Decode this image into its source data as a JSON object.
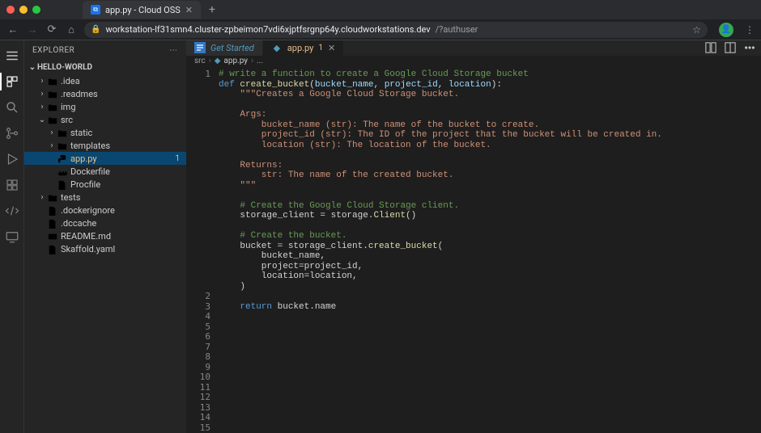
{
  "browser": {
    "tab_title": "app.py - Cloud OSS",
    "url_host": "workstation-lf31smn4.cluster-zpbeimon7vdi6xjptfsrgnp64y.cloudworkstations.dev",
    "url_path": "/?authuser"
  },
  "sidebar": {
    "title": "EXPLORER",
    "project": "HELLO-WORLD"
  },
  "tree": [
    {
      "depth": 1,
      "chev": "›",
      "kind": "folder",
      "label": ".idea"
    },
    {
      "depth": 1,
      "chev": "›",
      "kind": "folder",
      "label": ".readmes"
    },
    {
      "depth": 1,
      "chev": "›",
      "kind": "folder",
      "label": "img"
    },
    {
      "depth": 1,
      "chev": "⌄",
      "kind": "folder",
      "label": "src"
    },
    {
      "depth": 2,
      "chev": "›",
      "kind": "folder",
      "label": "static"
    },
    {
      "depth": 2,
      "chev": "›",
      "kind": "folder",
      "label": "templates"
    },
    {
      "depth": 2,
      "chev": "",
      "kind": "py",
      "label": "app.py",
      "selected": true,
      "modified": true,
      "badge": "1"
    },
    {
      "depth": 2,
      "chev": "",
      "kind": "docker",
      "label": "Dockerfile"
    },
    {
      "depth": 2,
      "chev": "",
      "kind": "file",
      "label": "Procfile"
    },
    {
      "depth": 1,
      "chev": "›",
      "kind": "folder",
      "label": "tests"
    },
    {
      "depth": 1,
      "chev": "",
      "kind": "file",
      "label": ".dockerignore"
    },
    {
      "depth": 1,
      "chev": "",
      "kind": "file",
      "label": ".dccache"
    },
    {
      "depth": 1,
      "chev": "",
      "kind": "md",
      "label": "README.md"
    },
    {
      "depth": 1,
      "chev": "",
      "kind": "yaml",
      "label": "Skaffold.yaml"
    }
  ],
  "editor_tabs": [
    {
      "kind": "gs",
      "label": "Get Started",
      "active": false
    },
    {
      "kind": "py",
      "label": "app.py",
      "badge": "1",
      "active": true,
      "closeable": true
    }
  ],
  "breadcrumb": {
    "seg1": "src",
    "seg2": "app.py",
    "seg3": "..."
  },
  "code_lines": [
    {
      "n": "1",
      "html": "<span class='tok-comment'># write a function to create a Google Cloud Storage bucket</span>"
    },
    {
      "n": "",
      "html": "<span class='tok-kw'>def</span> <span class='tok-fn'>create_bucket</span>(<span class='tok-param'>bucket_name</span>, <span class='tok-param'>project_id</span>, <span class='tok-param'>location</span>):"
    },
    {
      "n": "",
      "html": "    <span class='tok-str'>\"\"\"Creates a Google Cloud Storage bucket.</span>"
    },
    {
      "n": "",
      "html": ""
    },
    {
      "n": "",
      "html": "<span class='tok-str'>    Args:</span>"
    },
    {
      "n": "",
      "html": "<span class='tok-str'>        bucket_name (str): The name of the bucket to create.</span>"
    },
    {
      "n": "",
      "html": "<span class='tok-str'>        project_id (str): The ID of the project that the bucket will be created in.</span>"
    },
    {
      "n": "",
      "html": "<span class='tok-str'>        location (str): The location of the bucket.</span>"
    },
    {
      "n": "",
      "html": ""
    },
    {
      "n": "",
      "html": "<span class='tok-str'>    Returns:</span>"
    },
    {
      "n": "",
      "html": "<span class='tok-str'>        str: The name of the created bucket.</span>"
    },
    {
      "n": "",
      "html": "<span class='tok-str'>    \"\"\"</span>"
    },
    {
      "n": "",
      "html": ""
    },
    {
      "n": "",
      "html": "    <span class='tok-comment'># Create the Google Cloud Storage client.</span>"
    },
    {
      "n": "",
      "html": "    storage_client = storage.<span class='tok-fn'>Client</span>()"
    },
    {
      "n": "",
      "html": ""
    },
    {
      "n": "",
      "html": "    <span class='tok-comment'># Create the bucket.</span>"
    },
    {
      "n": "",
      "html": "    bucket = storage_client.<span class='tok-fn'>create_bucket</span>("
    },
    {
      "n": "",
      "html": "        bucket_name,"
    },
    {
      "n": "",
      "html": "        project=project_id,"
    },
    {
      "n": "",
      "html": "        location=location,"
    },
    {
      "n": "",
      "html": "    )"
    },
    {
      "n": "2",
      "html": ""
    },
    {
      "n": "3",
      "html": "    <span class='tok-kw'>return</span> bucket.name"
    },
    {
      "n": "4",
      "html": ""
    },
    {
      "n": "5",
      "html": ""
    },
    {
      "n": "6",
      "html": ""
    },
    {
      "n": "7",
      "html": ""
    },
    {
      "n": "8",
      "html": ""
    },
    {
      "n": "9",
      "html": ""
    },
    {
      "n": "10",
      "html": ""
    },
    {
      "n": "11",
      "html": ""
    },
    {
      "n": "12",
      "html": ""
    },
    {
      "n": "13",
      "html": ""
    },
    {
      "n": "14",
      "html": ""
    },
    {
      "n": "15",
      "html": ""
    }
  ]
}
